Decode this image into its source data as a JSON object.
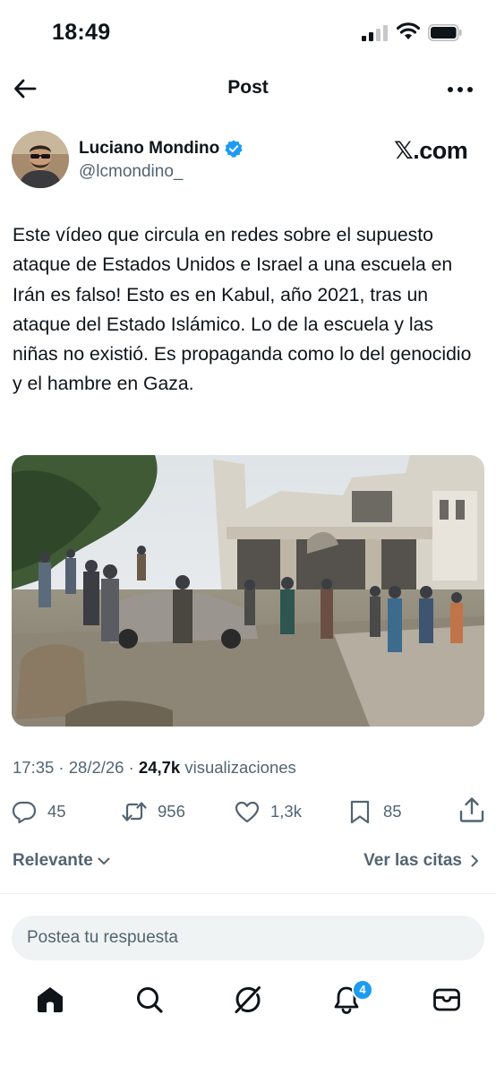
{
  "status_bar": {
    "time": "18:49"
  },
  "header": {
    "title": "Post"
  },
  "author": {
    "name": "Luciano Mondino",
    "handle": "@lcmondino_",
    "source_logo": "𝕏.com"
  },
  "tweet": {
    "text": "Este vídeo que circula en redes sobre el supuesto ataque de Estados Unidos e Israel a una escuela en Irán es falso! Esto es en Kabul, año 2021, tras un ataque del Estado Islámico. Lo de la escuela y las niñas no existió. Es propaganda como lo del genocidio y el hambre en Gaza.",
    "meta_time": "17:35 · 28/2/26 · ",
    "views_count": "24,7k",
    "views_label": " visualizaciones"
  },
  "actions": {
    "replies": "45",
    "reposts": "956",
    "likes": "1,3k",
    "bookmarks": "85"
  },
  "filters": {
    "sort_label": "Relevante",
    "quotes_label": "Ver las citas"
  },
  "reply_box": {
    "placeholder": "Postea tu respuesta"
  },
  "nav": {
    "notifications_badge": "4"
  },
  "colors": {
    "accent": "#1d9bf0",
    "text": "#0f1419",
    "muted": "#536471",
    "input_bg": "#eff3f4"
  }
}
